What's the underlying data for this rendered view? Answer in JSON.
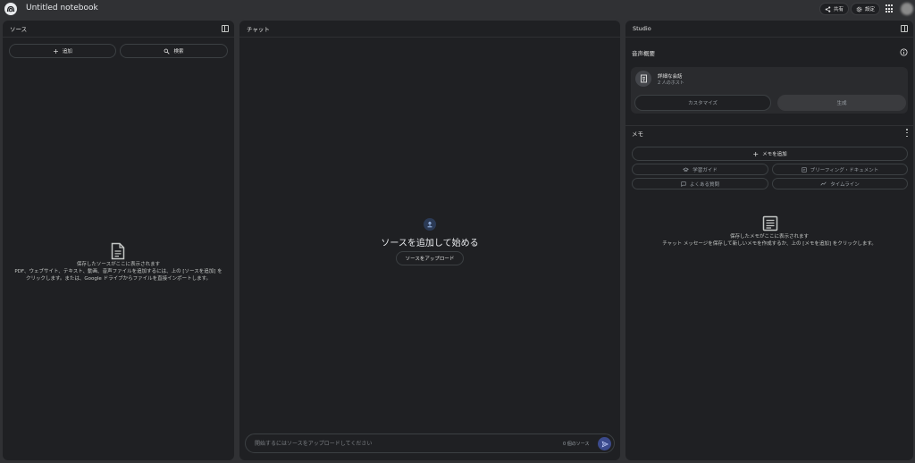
{
  "header": {
    "notebook_title": "Untitled notebook",
    "share_label": "共有",
    "settings_label": "設定"
  },
  "sources": {
    "title": "ソース",
    "add_label": "追加",
    "search_label": "検索",
    "empty_title": "保存したソースがここに表示されます",
    "empty_line1": "PDF、ウェブサイト、テキスト、動画、音声ファイルを追加するには、上の [ソースを追加] を",
    "empty_line2": "クリックします。または、Google ドライブからファイルを直接インポートします。"
  },
  "chat": {
    "title": "チャット",
    "heading": "ソースを追加して始める",
    "upload_label": "ソースをアップロード",
    "input_placeholder": "開始するにはソースをアップロードしてください",
    "source_count": "0 個のソース"
  },
  "studio": {
    "title": "Studio",
    "audio_section": "音声概要",
    "audio_card_title": "詳細な会話",
    "audio_card_subtitle": "2 人のホスト",
    "customize_label": "カスタマイズ",
    "generate_label": "生成",
    "notes_section": "メモ",
    "add_note_label": "メモを追加",
    "study_guide_label": "学習ガイド",
    "briefing_label": "ブリーフィング・ドキュメント",
    "faq_label": "よくある質問",
    "timeline_label": "タイムライン",
    "empty_title": "保存したメモがここに表示されます",
    "empty_line": "チャット メッセージを保存して新しいメモを作成するか、上の [メモを追加] をクリックします。"
  }
}
